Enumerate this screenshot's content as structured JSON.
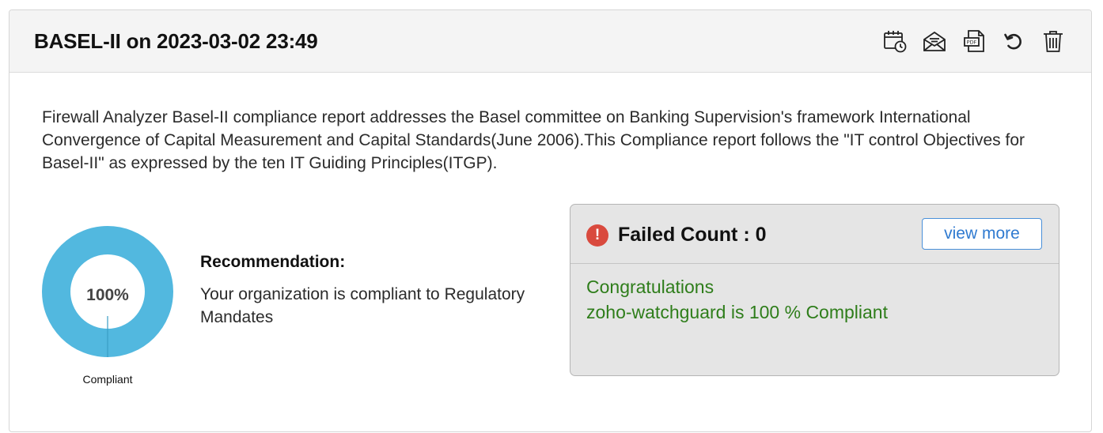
{
  "header": {
    "title": "BASEL-II on 2023-03-02 23:49",
    "actions": [
      {
        "name": "schedule-icon",
        "label": "Schedule"
      },
      {
        "name": "email-icon",
        "label": "Email"
      },
      {
        "name": "pdf-icon",
        "label": "PDF"
      },
      {
        "name": "refresh-icon",
        "label": "Refresh"
      },
      {
        "name": "delete-icon",
        "label": "Delete"
      }
    ],
    "pdf_text": "PDF"
  },
  "description": "Firewall Analyzer Basel-II compliance report addresses the Basel committee on Banking Supervision's framework International Convergence of Capital Measurement and Capital Standards(June 2006).This Compliance report follows the \"IT control Objectives for Basel-II\" as expressed by the ten IT Guiding Principles(ITGP).",
  "donut": {
    "percent_label": "100%",
    "percent_value": 100,
    "caption": "Compliant",
    "color": "#52b8df"
  },
  "recommendation": {
    "title": "Recommendation:",
    "text": "Your organization is compliant to Regulatory Mandates"
  },
  "status": {
    "alert_glyph": "!",
    "failed_label": "Failed Count : 0",
    "view_more": "view more",
    "line1": "Congratulations",
    "line2": "zoho-watchguard is 100 % Compliant",
    "alert_color": "#d94a3e",
    "success_color": "#2e7d1a",
    "link_color": "#2f7ad0"
  }
}
